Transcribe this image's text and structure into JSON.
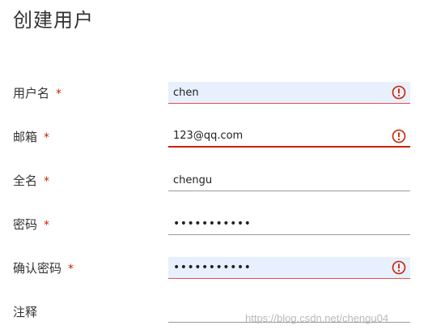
{
  "page": {
    "title": "创建用户"
  },
  "form": {
    "required_mark": "*",
    "fields": [
      {
        "label": "用户名",
        "value": "chen",
        "required": true,
        "state": "error"
      },
      {
        "label": "邮箱",
        "value": "123@qq.com",
        "required": true,
        "state": "error-focused"
      },
      {
        "label": "全名",
        "value": "chengu",
        "required": true,
        "state": "normal"
      },
      {
        "label": "密码",
        "value": "•••••••••••",
        "required": true,
        "state": "normal"
      },
      {
        "label": "确认密码",
        "value": "•••••••••••",
        "required": true,
        "state": "error"
      },
      {
        "label": "注释",
        "value": "",
        "required": false,
        "state": "normal"
      }
    ]
  },
  "icons": {
    "error": "error-exclamation-circle-icon"
  },
  "colors": {
    "error": "#c92100",
    "required": "#c92100",
    "autofill_background": "#e8f0fe",
    "underline": "#9a9a9a"
  },
  "watermark": "https://blog.csdn.net/chengu04"
}
